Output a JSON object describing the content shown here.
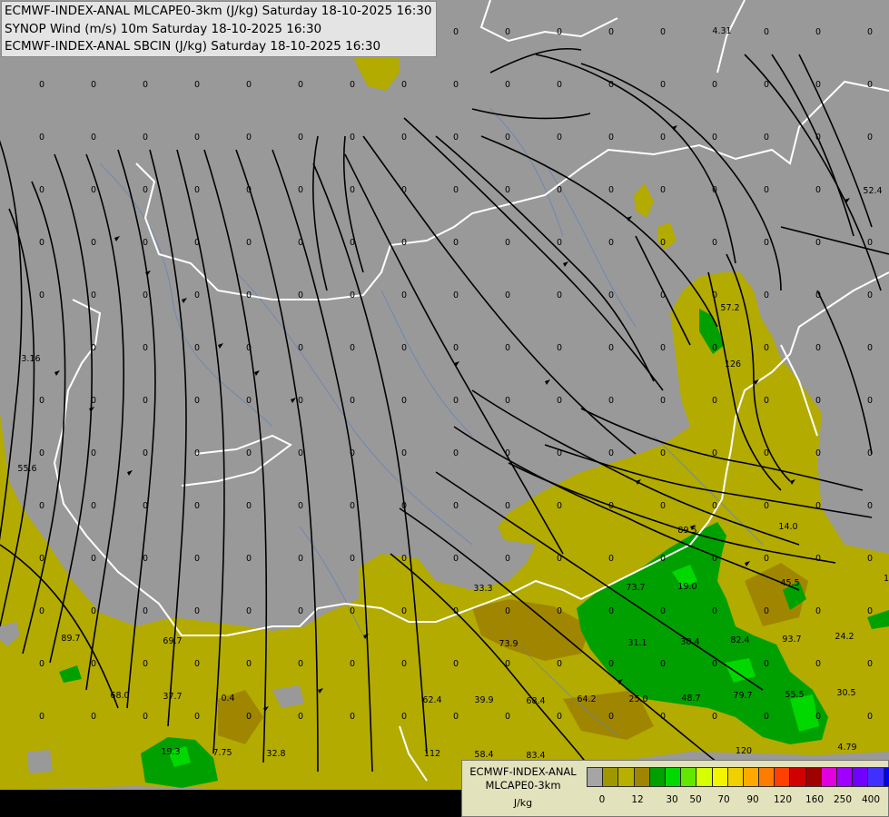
{
  "header": {
    "title_lines": [
      "ECMWF-INDEX-ANAL MLCAPE0-3km (J/kg) Saturday 18-10-2025 16:30",
      "SYNOP Wind (m/s) 10m Saturday 18-10-2025 16:30",
      "ECMWF-INDEX-ANAL SBCIN (J/kg) Saturday 18-10-2025 16:30"
    ]
  },
  "legend": {
    "title_line1": "ECMWF-INDEX-ANAL",
    "title_line2": "MLCAPE0-3km",
    "unit": "J/kg",
    "colors": [
      "#a5a5a5",
      "#9e9700",
      "#b7b000",
      "#a08600",
      "#00a000",
      "#00d800",
      "#62e800",
      "#d6ff00",
      "#f4f400",
      "#f0d000",
      "#ffa800",
      "#ff7c00",
      "#ff4000",
      "#d00000",
      "#a00000",
      "#e000e0",
      "#a000ff",
      "#7000ff",
      "#4030ff",
      "#0000ff",
      "#0078ff",
      "#00c0ff",
      "#60ffff",
      "#ffffff"
    ],
    "tick_labels": [
      "0",
      "12",
      "30",
      "50",
      "70",
      "90",
      "120",
      "160",
      "250",
      "400"
    ]
  },
  "map_values": [
    {
      "t": "4.31"
    },
    {
      "t": "52.4"
    },
    {
      "t": "57.2"
    },
    {
      "t": "126"
    },
    {
      "t": "3.16"
    },
    {
      "t": "55.6"
    },
    {
      "t": "14.0"
    },
    {
      "t": "89.5"
    },
    {
      "t": "33.3"
    },
    {
      "t": "73.7"
    },
    {
      "t": "19.0"
    },
    {
      "t": "45.5"
    },
    {
      "t": "31.1"
    },
    {
      "t": "30.4"
    },
    {
      "t": "82.4"
    },
    {
      "t": "93.7"
    },
    {
      "t": "24.2"
    },
    {
      "t": "89.7"
    },
    {
      "t": "69.7"
    },
    {
      "t": "73.9"
    },
    {
      "t": "68.0"
    },
    {
      "t": "37.7"
    },
    {
      "t": "0.4"
    },
    {
      "t": "62.4"
    },
    {
      "t": "39.9"
    },
    {
      "t": "68.4"
    },
    {
      "t": "64.2"
    },
    {
      "t": "25.0"
    },
    {
      "t": "48.7"
    },
    {
      "t": "79.7"
    },
    {
      "t": "55.5"
    },
    {
      "t": "30.5"
    },
    {
      "t": "19.3"
    },
    {
      "t": "7.75"
    },
    {
      "t": "32.8"
    },
    {
      "t": "112"
    },
    {
      "t": "58.4"
    },
    {
      "t": "83.4"
    },
    {
      "t": "120"
    },
    {
      "t": "4.79"
    },
    {
      "t": "1"
    }
  ],
  "zero_label": "0"
}
